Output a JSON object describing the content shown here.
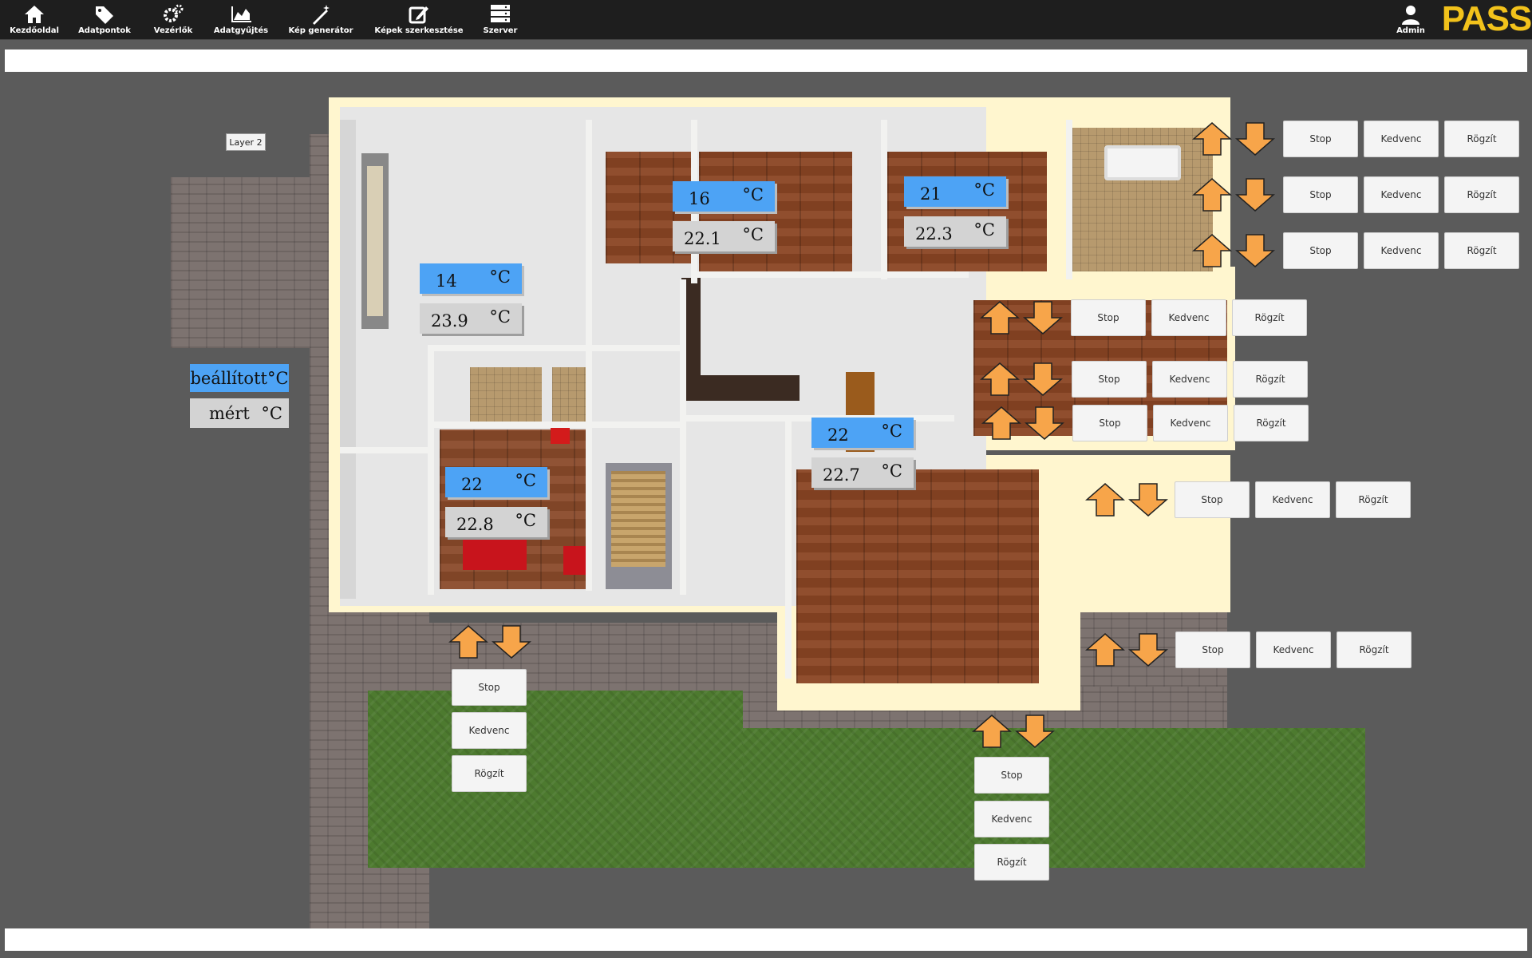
{
  "nav": {
    "items": [
      {
        "label": "Kezdőoldal",
        "icon": "home-icon"
      },
      {
        "label": "Adatpontok",
        "icon": "tags-icon"
      },
      {
        "label": "Vezérlők",
        "icon": "gears-icon"
      },
      {
        "label": "Adatgyűjtés",
        "icon": "area-chart-icon"
      },
      {
        "label": "Kép generátor",
        "icon": "magic-wand-icon"
      },
      {
        "label": "Képek szerkesztése",
        "icon": "edit-icon"
      },
      {
        "label": "Szerver",
        "icon": "server-icon"
      }
    ],
    "user": {
      "label": "Admin",
      "icon": "user-icon"
    },
    "logo": "PASS"
  },
  "canvas": {
    "layer_label": "Layer 2",
    "legend": {
      "set": "beállított°C",
      "measured": "mért",
      "unit": "°C"
    }
  },
  "rooms": [
    {
      "id": "room-left",
      "set": "14",
      "measured": "23.9",
      "unit": "°C"
    },
    {
      "id": "room-hall",
      "set": "16",
      "measured": "22.1",
      "unit": "°C"
    },
    {
      "id": "room-bed",
      "set": "21",
      "measured": "22.3",
      "unit": "°C"
    },
    {
      "id": "room-living",
      "set": "22",
      "measured": "22.8",
      "unit": "°C"
    },
    {
      "id": "room-dining",
      "set": "22",
      "measured": "22.7",
      "unit": "°C"
    }
  ],
  "shutter": {
    "stop": "Stop",
    "favorite": "Kedvenc",
    "record": "Rögzít"
  },
  "colors": {
    "accent": "#4da3f5",
    "arrow": "#f7a54a",
    "topbar": "#1e1e1e",
    "logo": "#f2c21b"
  }
}
